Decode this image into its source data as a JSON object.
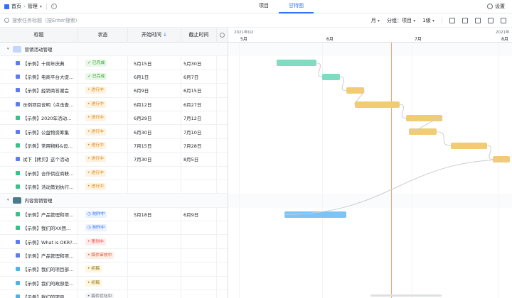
{
  "breadcrumb": {
    "home": "首页",
    "current": "管理"
  },
  "tabs": [
    {
      "label": "项目",
      "active": false
    },
    {
      "label": "甘特图",
      "active": true
    }
  ],
  "settings_label": "设置",
  "search": {
    "placeholder": "搜索任务标题（按Enter搜索）"
  },
  "toolbar": {
    "scale": "月",
    "group": "分组：项目",
    "level": "1级"
  },
  "columns": {
    "title": "标题",
    "status": "状态",
    "start": "开始时间",
    "end": "截止时间"
  },
  "colors": {
    "accent": "#3370ff",
    "green_bar": "#7fdcc0",
    "yellow_bar": "#f2cc73",
    "blue_bar": "#7cc4f8",
    "today_line": "#f0a677"
  },
  "groups": [
    {
      "name": "营销活动管理",
      "icon": "folder-icon",
      "rows": [
        {
          "title": "【示例】十周年庆典",
          "status": "已完成",
          "kind": "done",
          "start": "5月15日",
          "end": "5月30日",
          "icon_color": "#5b7cf5"
        },
        {
          "title": "【示例】电商平台大促…",
          "status": "已完成",
          "kind": "done",
          "start": "6月1日",
          "end": "6月7日",
          "icon_color": "#5b7cf5"
        },
        {
          "title": "【示例】经销商答谢会",
          "status": "进行中",
          "kind": "doing",
          "start": "6月9日",
          "end": "6月15日",
          "icon_color": "#5b7cf5"
        },
        {
          "title": "示例项目说明（点击查…",
          "status": "进行中",
          "kind": "doing",
          "start": "6月12日",
          "end": "6月27日",
          "icon_color": "#5b7cf5"
        },
        {
          "title": "【示例】2020年活动…",
          "status": "进行中",
          "kind": "doing",
          "start": "6月29日",
          "end": "7月12日",
          "icon_color": "#34c389"
        },
        {
          "title": "【示例】公益物资筹集",
          "status": "进行中",
          "kind": "doing",
          "start": "6月30日",
          "end": "7月10日",
          "icon_color": "#5b7cf5"
        },
        {
          "title": "【示例】常用物料&设…",
          "status": "进行中",
          "kind": "doing",
          "start": "7月15日",
          "end": "7月28日",
          "icon_color": "#34c389"
        },
        {
          "title": "试下【拷贝】这个活动",
          "status": "进行中",
          "kind": "doing",
          "start": "7月30日",
          "end": "8月5日",
          "icon_color": "#5b7cf5"
        },
        {
          "title": "【示例】合作供应商联…",
          "status": "进行中",
          "kind": "doing",
          "start": "",
          "end": "",
          "icon_color": "#34c389"
        },
        {
          "title": "【示例】活动策划执行…",
          "status": "进行中",
          "kind": "doing",
          "start": "",
          "end": "",
          "icon_color": "#34c389"
        }
      ]
    },
    {
      "name": "内容营销管理",
      "icon": "image-icon",
      "rows": [
        {
          "title": "【示例】产品管理和项…",
          "status": "制作中",
          "kind": "making",
          "start": "5月18日",
          "end": "6月9日",
          "icon_color": "#34c389"
        },
        {
          "title": "【示例】我们的XX团…",
          "status": "制作中",
          "kind": "making",
          "start": "",
          "end": "",
          "icon_color": "#34c389"
        },
        {
          "title": "【示例】What is OKR?…",
          "status": "策划中",
          "kind": "planning",
          "start": "",
          "end": "",
          "icon_color": "#5b7cf5"
        },
        {
          "title": "【示例】产品管理和项…",
          "status": "稿件审核中",
          "kind": "review",
          "start": "",
          "end": "",
          "icon_color": "#5b7cf5"
        },
        {
          "title": "【示例】我们的项目部…",
          "status": "初稿",
          "kind": "draft",
          "start": "",
          "end": "",
          "icon_color": "#4bb4e6"
        },
        {
          "title": "【示例】我们的政部是…",
          "status": "初稿",
          "kind": "draft",
          "start": "",
          "end": "",
          "icon_color": "#4bb4e6"
        },
        {
          "title": "【示例】我们的项目…",
          "status": "稿件优化中",
          "kind": "optimize",
          "start": "",
          "end": "",
          "icon_color": "#4bb4e6"
        }
      ]
    }
  ],
  "gantt_header": {
    "quarter": "2021年Q2",
    "quarter_right": "2021年",
    "months": [
      "5月",
      "6月",
      "7月",
      "8月"
    ]
  }
}
